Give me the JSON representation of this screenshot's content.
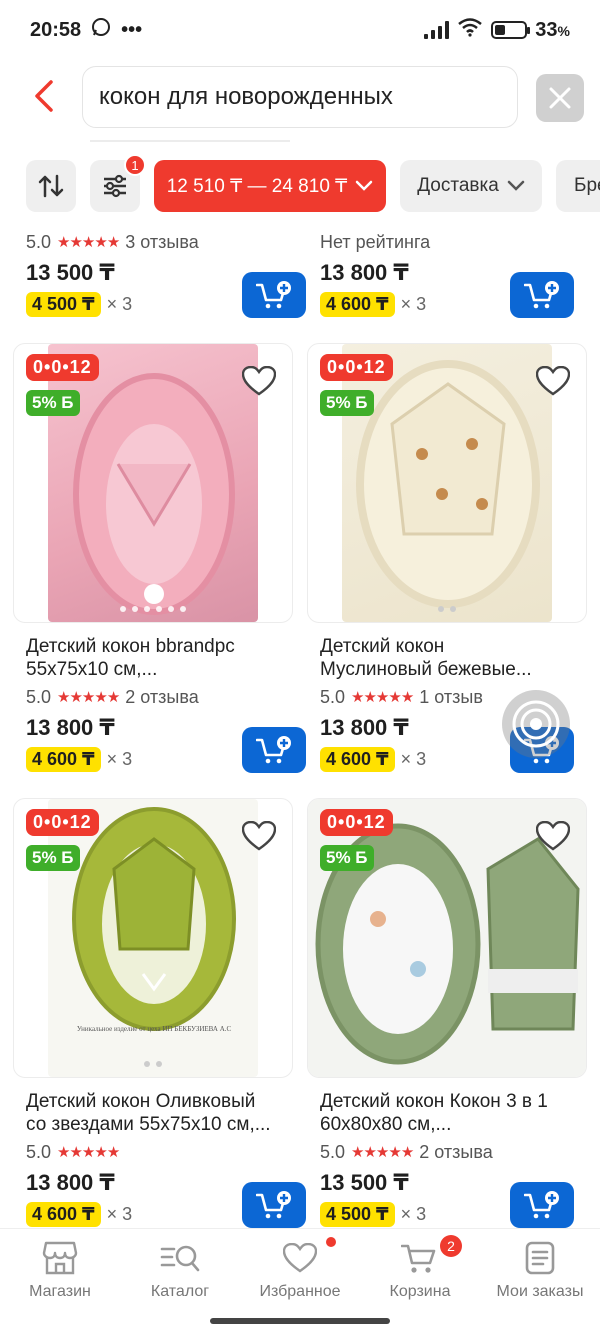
{
  "status_bar": {
    "time": "20:58",
    "battery": "33",
    "battery_unit": "%"
  },
  "search": {
    "query": "кокон для новорожденных"
  },
  "filters": {
    "sort_icon": "sort-icon",
    "filter_badge": "1",
    "price_range": "12 510 ₸ — 24 810 ₸",
    "delivery": "Доставка",
    "brand_partial": "Бре"
  },
  "top_row": [
    {
      "rating": "5.0",
      "reviews": "3 отзыва",
      "price": "13 500 ₸",
      "installment": "4 500 ₸",
      "mult": "× 3"
    },
    {
      "rating": "",
      "reviews": "Нет рейтинга",
      "price": "13 800 ₸",
      "installment": "4 600 ₸",
      "mult": "× 3"
    }
  ],
  "products": [
    {
      "timer": "0•0•12",
      "discount": "5% Б",
      "title_line1": "Детский кокон bbrandpc",
      "title_line2": "55х75х10 см,...",
      "rating": "5.0",
      "reviews": "2 отзыва",
      "price": "13 800 ₸",
      "installment": "4 600 ₸",
      "mult": "× 3",
      "image": "pink-cocoon"
    },
    {
      "timer": "0•0•12",
      "discount": "5% Б",
      "title_line1": "Детский кокон",
      "title_line2": "Муслиновый бежевые...",
      "rating": "5.0",
      "reviews": "1 отзыв",
      "price": "13 800 ₸",
      "installment": "4 600 ₸",
      "mult": "× 3",
      "image": "beige-cocoon"
    },
    {
      "timer": "0•0•12",
      "discount": "5% Б",
      "title_line1": "Детский кокон Оливковый",
      "title_line2": "со звездами 55х75х10 см,...",
      "rating": "5.0",
      "reviews": "",
      "price": "13 800 ₸",
      "installment": "4 600 ₸",
      "mult": "× 3",
      "image": "olive-cocoon"
    },
    {
      "timer": "0•0•12",
      "discount": "5% Б",
      "title_line1": "Детский кокон Кокон 3 в 1",
      "title_line2": "60х80х80 см,...",
      "rating": "5.0",
      "reviews": "2 отзыва",
      "price": "13 500 ₸",
      "installment": "4 500 ₸",
      "mult": "× 3",
      "image": "green-cocoon-set"
    }
  ],
  "bottom_nav": [
    {
      "label": "Магазин",
      "icon": "store-icon"
    },
    {
      "label": "Каталог",
      "icon": "catalog-search-icon"
    },
    {
      "label": "Избранное",
      "icon": "heart-icon"
    },
    {
      "label": "Корзина",
      "icon": "cart-icon",
      "badge": "2"
    },
    {
      "label": "Мои заказы",
      "icon": "orders-icon"
    }
  ],
  "colors": {
    "accent_red": "#ef3a2e",
    "cart_blue": "#0c67d4",
    "installment_yellow": "#ffe100",
    "discount_green": "#3fae2a"
  }
}
